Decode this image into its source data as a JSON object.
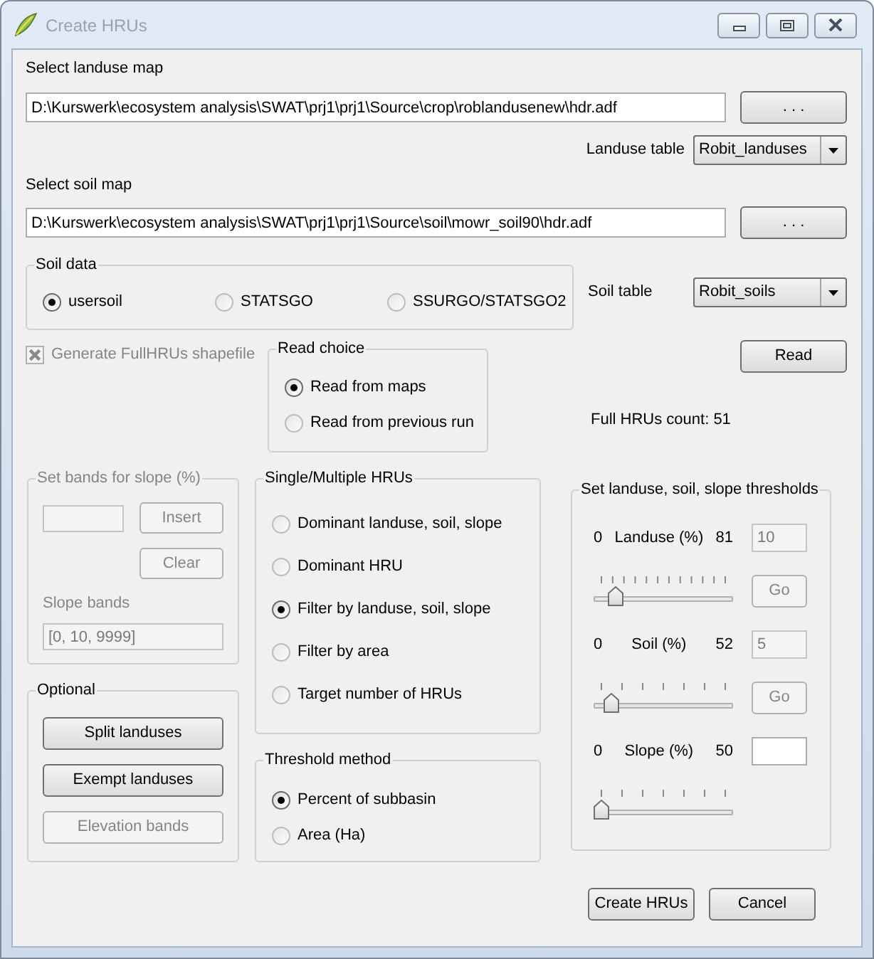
{
  "window": {
    "title": "Create HRUs"
  },
  "landuse_map": {
    "label": "Select landuse map",
    "value": "D:\\Kurswerk\\ecosystem analysis\\SWAT\\prj1\\prj1\\Source\\crop\\roblandusenew\\hdr.adf",
    "browse_button": ". . ."
  },
  "landuse_table": {
    "label": "Landuse table",
    "value": "Robit_landuses"
  },
  "soil_map": {
    "label": "Select soil map",
    "value": "D:\\Kurswerk\\ecosystem analysis\\SWAT\\prj1\\prj1\\Source\\soil\\mowr_soil90\\hdr.adf",
    "browse_button": ". . ."
  },
  "soil_data": {
    "title": "Soil data",
    "options": [
      {
        "label": "usersoil",
        "selected": true
      },
      {
        "label": "STATSGO",
        "selected": false
      },
      {
        "label": "SSURGO/STATSGO2",
        "selected": false
      }
    ]
  },
  "soil_table": {
    "label": "Soil table",
    "value": "Robit_soils"
  },
  "generate_shapefile": {
    "label": "Generate FullHRUs shapefile",
    "checked": true,
    "disabled": true
  },
  "read_choice": {
    "title": "Read choice",
    "options": [
      {
        "label": "Read from maps",
        "selected": true
      },
      {
        "label": "Read from previous run",
        "selected": false
      }
    ]
  },
  "read_button": {
    "label": "Read"
  },
  "full_hrus_count": "Full HRUs count: 51",
  "slope_bands": {
    "title": "Set bands for slope (%)",
    "disabled": true,
    "insert_button": "Insert",
    "clear_button": "Clear",
    "bands_label": "Slope bands",
    "bands_value": "[0, 10, 9999]"
  },
  "optional": {
    "title": "Optional",
    "buttons": [
      {
        "label": "Split landuses",
        "disabled": false
      },
      {
        "label": "Exempt landuses",
        "disabled": false
      },
      {
        "label": "Elevation bands",
        "disabled": true
      }
    ]
  },
  "hru_mode": {
    "title": "Single/Multiple HRUs",
    "options": [
      {
        "label": "Dominant landuse, soil, slope",
        "selected": false
      },
      {
        "label": "Dominant HRU",
        "selected": false
      },
      {
        "label": "Filter by landuse, soil, slope",
        "selected": true
      },
      {
        "label": "Filter by area",
        "selected": false
      },
      {
        "label": "Target number of HRUs",
        "selected": false
      }
    ]
  },
  "threshold_method": {
    "title": "Threshold method",
    "options": [
      {
        "label": "Percent of subbasin",
        "selected": true
      },
      {
        "label": "Area (Ha)",
        "selected": false
      }
    ]
  },
  "thresholds": {
    "title": "Set landuse, soil, slope thresholds",
    "rows": [
      {
        "min": "0",
        "label": "Landuse (%)",
        "max": "81",
        "value": "10",
        "level": 0.12,
        "disabled": true,
        "go_button": "Go"
      },
      {
        "min": "0",
        "label": "Soil (%)",
        "max": "52",
        "value": "5",
        "level": 0.08,
        "disabled": true,
        "go_button": "Go"
      },
      {
        "min": "0",
        "label": "Slope (%)",
        "max": "50",
        "level": 0,
        "disabled": false
      }
    ]
  },
  "buttons": [
    "Create HRUs",
    "Cancel"
  ]
}
